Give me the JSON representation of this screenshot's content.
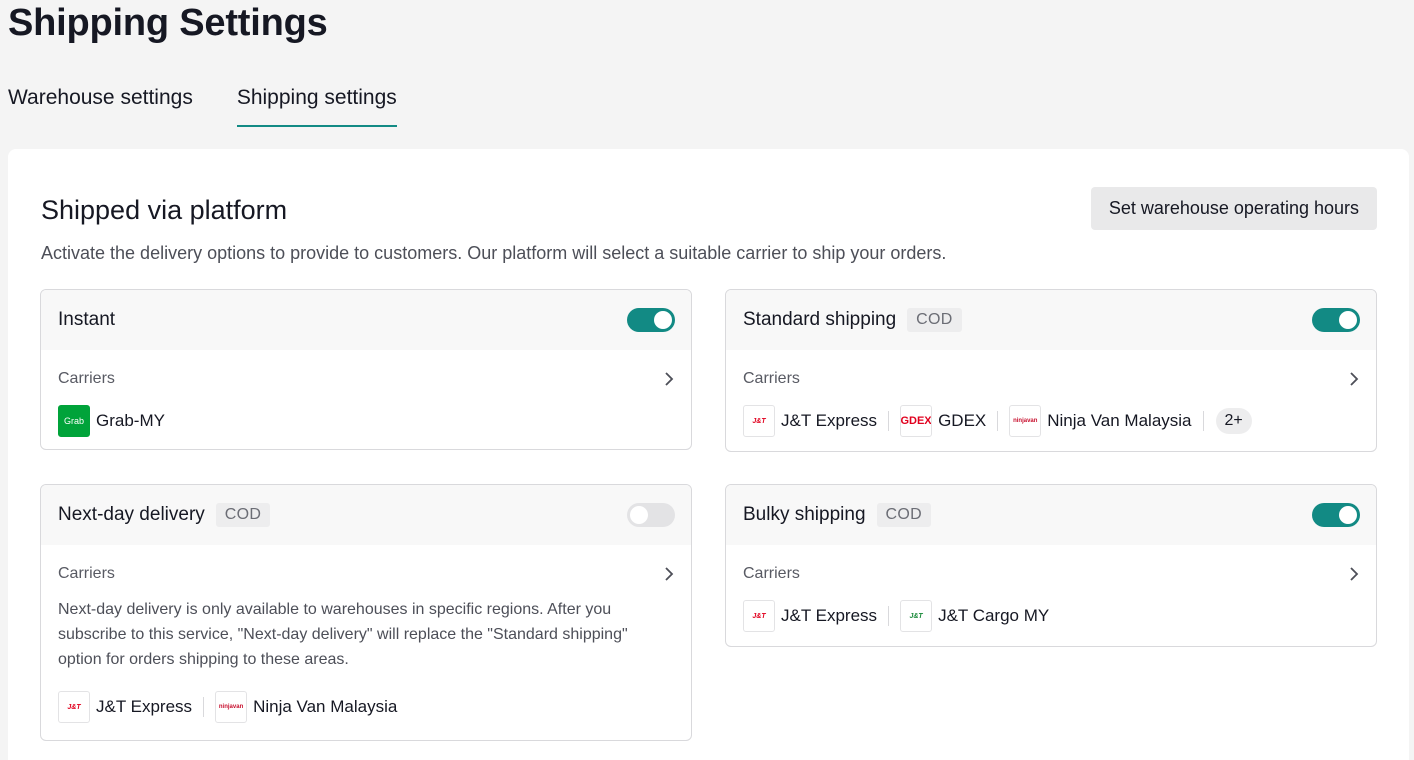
{
  "page": {
    "title": "Shipping Settings"
  },
  "tabs": [
    {
      "label": "Warehouse settings",
      "active": false
    },
    {
      "label": "Shipping settings",
      "active": true
    }
  ],
  "section": {
    "title": "Shipped via platform",
    "description": "Activate the delivery options to provide to customers. Our platform will select a suitable carrier to ship your orders.",
    "hours_button": "Set warehouse operating hours"
  },
  "colors": {
    "accent": "#128a84",
    "background": "#f4f4f4"
  },
  "cards": {
    "instant": {
      "title": "Instant",
      "enabled": true,
      "carriers_label": "Carriers",
      "carriers": [
        {
          "name": "Grab-MY",
          "logo": "Grab"
        }
      ]
    },
    "standard": {
      "title": "Standard shipping",
      "badge": "COD",
      "enabled": true,
      "carriers_label": "Carriers",
      "carriers": [
        {
          "name": "J&T Express",
          "logo": "J&T"
        },
        {
          "name": "GDEX",
          "logo": "GDEX"
        },
        {
          "name": "Ninja Van Malaysia",
          "logo": "ninjavan"
        }
      ],
      "more": "2+"
    },
    "nextday": {
      "title": "Next-day delivery",
      "badge": "COD",
      "enabled": false,
      "carriers_label": "Carriers",
      "note": "Next-day delivery is only available to warehouses in specific regions. After you subscribe to this service, \"Next-day delivery\" will replace the \"Standard shipping\" option for orders shipping to these areas.",
      "carriers": [
        {
          "name": "J&T Express",
          "logo": "J&T"
        },
        {
          "name": "Ninja Van Malaysia",
          "logo": "ninjavan"
        }
      ]
    },
    "bulky": {
      "title": "Bulky shipping",
      "badge": "COD",
      "enabled": true,
      "carriers_label": "Carriers",
      "carriers": [
        {
          "name": "J&T Express",
          "logo": "J&T"
        },
        {
          "name": "J&T Cargo MY",
          "logo": "J&T"
        }
      ]
    }
  },
  "icons": {
    "chevron": "chevron-right-icon"
  }
}
